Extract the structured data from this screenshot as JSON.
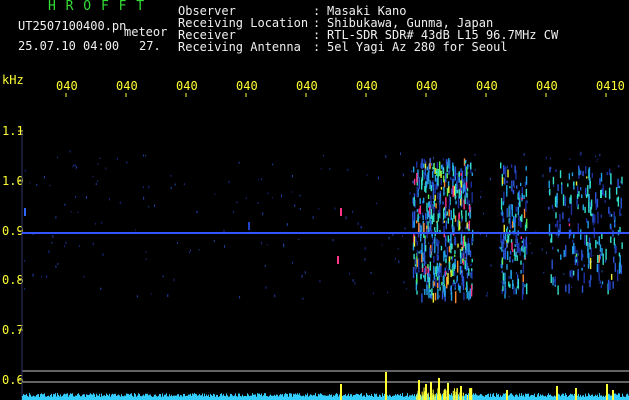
{
  "header": {
    "title": "H R O F F T",
    "file_name": "UT2507100400.pn",
    "mode": "meteor",
    "datetime": "25.07.10 04:00",
    "count": "27.",
    "fields": [
      {
        "label": "Observer",
        "value": "Masaki Kano"
      },
      {
        "label": "Receiving Location",
        "value": "Shibukawa, Gunma, Japan"
      },
      {
        "label": "Receiver",
        "value": "RTL-SDR SDR# 43dB L15 96.7MHz CW"
      },
      {
        "label": "Receiving Antenna",
        "value": "5el Yagi Az 280 for Seoul"
      }
    ],
    "separator": ":"
  },
  "axis": {
    "unit": "kHz",
    "x_ticks": [
      "040",
      "040",
      "040",
      "040",
      "040",
      "040",
      "040",
      "040",
      "040",
      "0410"
    ],
    "y_ticks": [
      "1.1",
      "1.0",
      "0.9",
      "0.8",
      "0.7",
      "0.6"
    ]
  },
  "colors": {
    "background": "#000000",
    "text": "#f0f0f0",
    "accent_yellow": "#ffff33",
    "title_green": "#33dd33",
    "signal_line": "#3355ff",
    "noise_bar": "#33ccff",
    "burst_bar": "#ffff33"
  }
}
